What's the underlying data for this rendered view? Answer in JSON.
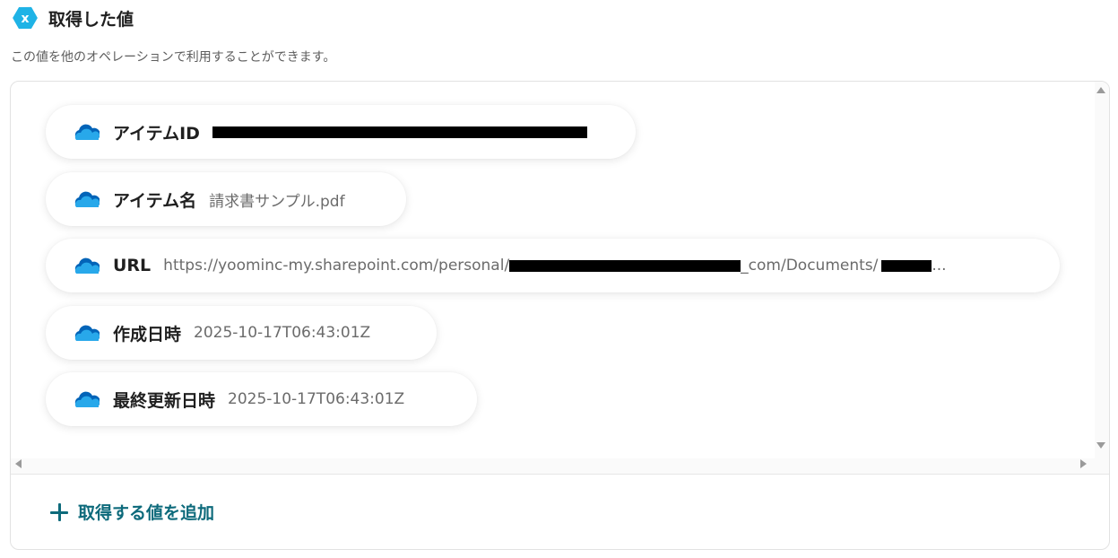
{
  "header": {
    "logo_icon": "yoom-hexagon-x-icon",
    "logo_color": "#1fb3e6",
    "logo_letter": "x",
    "title": "取得した値"
  },
  "description": "この値を他のオペレーションで利用することができます。",
  "fields": [
    {
      "icon": "onedrive-cloud-icon",
      "key": "アイテムID",
      "value": "",
      "value_prefix": "",
      "value_suffix": "",
      "redacted": true
    },
    {
      "icon": "onedrive-cloud-icon",
      "key": "アイテム名",
      "value": "請求書サンプル.pdf"
    },
    {
      "icon": "onedrive-cloud-icon",
      "key": "URL",
      "value_prefix": "https://yoominc-my.sharepoint.com/personal/",
      "value_middle": "_com/Documents/",
      "value_suffix": "...",
      "redacted": true
    },
    {
      "icon": "onedrive-cloud-icon",
      "key": "作成日時",
      "value": "2025-10-17T06:43:01Z"
    },
    {
      "icon": "onedrive-cloud-icon",
      "key": "最終更新日時",
      "value": "2025-10-17T06:43:01Z"
    }
  ],
  "add_button": {
    "label": "取得する値を追加",
    "icon": "plus-icon",
    "color": "#0d6a7b"
  },
  "colors": {
    "cloud_dark": "#0364b8",
    "cloud_light": "#28a8ea"
  }
}
